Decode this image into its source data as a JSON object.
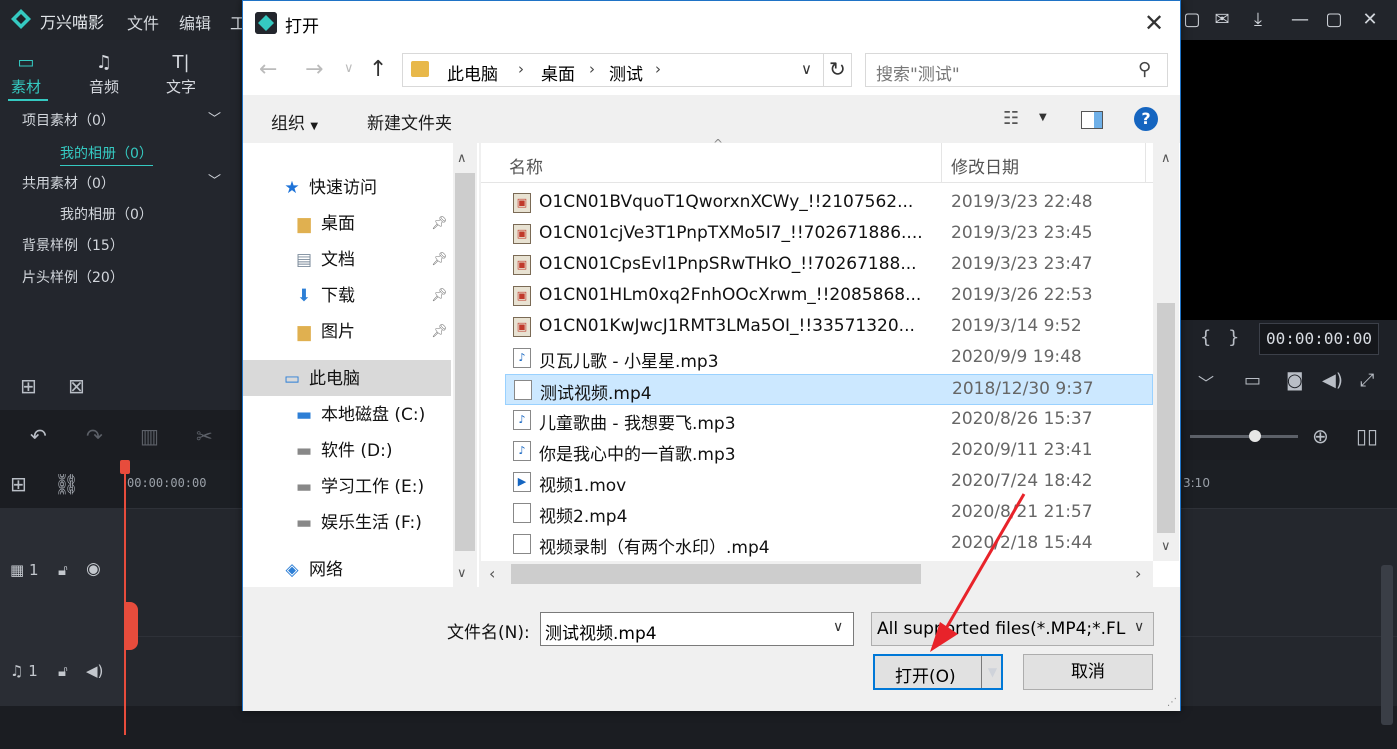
{
  "app": {
    "title": "万兴喵影",
    "menus": [
      "文件",
      "编辑",
      "工"
    ],
    "side_tabs": [
      {
        "label": "素材",
        "icon": "folder-icon"
      },
      {
        "label": "音频",
        "icon": "music-note-icon"
      },
      {
        "label": "文字",
        "icon": "text-icon"
      }
    ],
    "library": {
      "project": "项目素材（0）",
      "project_album": "我的相册（0）",
      "shared": "共用素材（0）",
      "shared_album": "我的相册（0）",
      "backgrounds": "背景样例（15）",
      "intros": "片头样例（20）"
    },
    "timecode": "00:00:00:00",
    "ruler_start": "00:00:00:00",
    "ruler_end_label": "3:10",
    "track_video": "1",
    "track_audio": "1"
  },
  "dialog": {
    "title": "打开",
    "breadcrumb": [
      "此电脑",
      "桌面",
      "测试"
    ],
    "search_placeholder": "搜索\"测试\"",
    "organize": "组织",
    "new_folder": "新建文件夹",
    "help": "?",
    "columns": {
      "name": "名称",
      "modified": "修改日期"
    },
    "nav": {
      "quick_access": "快速访问",
      "desktop": "桌面",
      "documents": "文档",
      "downloads": "下载",
      "pictures": "图片",
      "this_pc": "此电脑",
      "drive_c": "本地磁盘 (C:)",
      "drive_d": "软件 (D:)",
      "drive_e": "学习工作 (E:)",
      "drive_f": "娱乐生活 (F:)",
      "network": "网络"
    },
    "files": [
      {
        "name": "O1CN01BVquoT1QworxnXCWy_!!2107562...",
        "date": "2019/3/23 22:48",
        "type": "image"
      },
      {
        "name": "O1CN01cjVe3T1PnpTXMo5I7_!!702671886....",
        "date": "2019/3/23 23:45",
        "type": "image"
      },
      {
        "name": "O1CN01CpsEvl1PnpSRwTHkO_!!70267188...",
        "date": "2019/3/23 23:47",
        "type": "image"
      },
      {
        "name": "O1CN01HLm0xq2FnhOOcXrwm_!!2085868...",
        "date": "2019/3/26 22:53",
        "type": "image"
      },
      {
        "name": "O1CN01KwJwcJ1RMT3LMa5OI_!!33571320...",
        "date": "2019/3/14 9:52",
        "type": "image"
      },
      {
        "name": "贝瓦儿歌 - 小星星.mp3",
        "date": "2020/9/9 19:48",
        "type": "audio"
      },
      {
        "name": "测试视频.mp4",
        "date": "2018/12/30 9:37",
        "type": "video",
        "selected": true
      },
      {
        "name": "儿童歌曲 - 我想要飞.mp3",
        "date": "2020/8/26 15:37",
        "type": "audio"
      },
      {
        "name": "你是我心中的一首歌.mp3",
        "date": "2020/9/11 23:41",
        "type": "audio"
      },
      {
        "name": "视频1.mov",
        "date": "2020/7/24 18:42",
        "type": "mov"
      },
      {
        "name": "视频2.mp4",
        "date": "2020/8/21 21:57",
        "type": "video"
      },
      {
        "name": "视频录制（有两个水印）.mp4",
        "date": "2020/2/18 15:44",
        "type": "video"
      }
    ],
    "filename_label": "文件名(N):",
    "filename_value": "测试视频.mp4",
    "filetype_value": "All supported files(*.MP4;*.FL",
    "open_button": "打开(O)",
    "cancel_button": "取消"
  },
  "colors": {
    "accent": "#35c9c1",
    "dialog_border": "#1f73c6",
    "selection": "#cce8ff",
    "annotation_arrow": "#e8232a"
  }
}
